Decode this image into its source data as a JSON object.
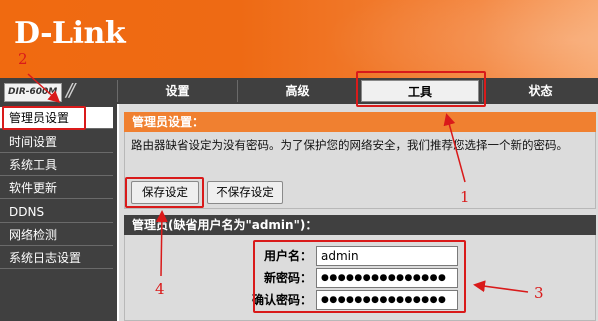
{
  "header": {
    "logo_text": "D-Link",
    "model": "DIR-600M",
    "separator": "//"
  },
  "tabs": [
    {
      "label": "设置",
      "active": false
    },
    {
      "label": "高级",
      "active": false
    },
    {
      "label": "工具",
      "active": true
    },
    {
      "label": "状态",
      "active": false
    }
  ],
  "sidebar": {
    "items": [
      {
        "label": "管理员设置",
        "active": true
      },
      {
        "label": "时间设置",
        "active": false
      },
      {
        "label": "系统工具",
        "active": false
      },
      {
        "label": "软件更新",
        "active": false
      },
      {
        "label": "DDNS",
        "active": false
      },
      {
        "label": "网络检测",
        "active": false
      },
      {
        "label": "系统日志设置",
        "active": false
      }
    ]
  },
  "admin_settings": {
    "title": "管理员设置：",
    "description": "路由器缺省设定为没有密码。为了保护您的网络安全，我们推荐您选择一个新的密码。",
    "save_label": "保存设定",
    "dont_save_label": "不保存设定"
  },
  "admin_account": {
    "title": "管理员(缺省用户名为\"admin\")：",
    "username_label": "用户名：",
    "username_value": "admin",
    "new_password_label": "新密码：",
    "new_password_value": "●●●●●●●●●●●●●●●",
    "confirm_password_label": "确认密码：",
    "confirm_password_value": "●●●●●●●●●●●●●●●"
  },
  "annotations": {
    "n1": "1",
    "n2": "2",
    "n3": "3",
    "n4": "4"
  },
  "colors": {
    "accent_orange": "#f08030",
    "nav_dark": "#404040",
    "annotation_red": "#d91a1a"
  }
}
